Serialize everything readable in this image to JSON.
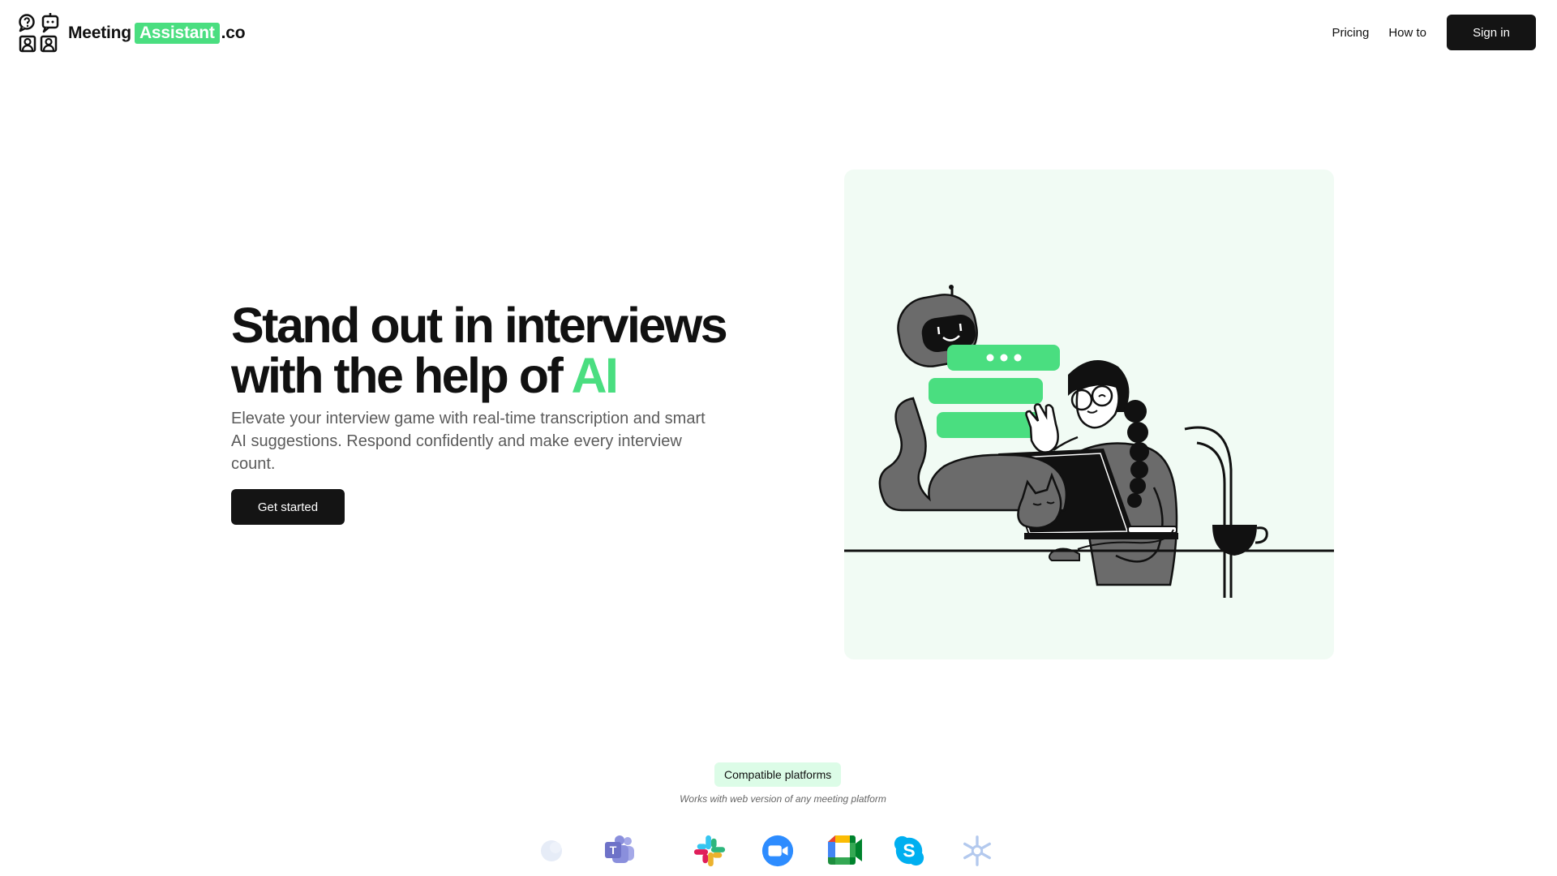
{
  "brand": {
    "name_prefix": "Meeting",
    "name_highlight": "Assistant",
    "name_suffix": ".co",
    "logo_icon": "chat-bot-people-icon"
  },
  "nav": {
    "pricing": "Pricing",
    "how_to": "How to",
    "sign_in": "Sign in"
  },
  "hero": {
    "title_line1": "Stand out in interviews",
    "title_line2_prefix": "with the help of ",
    "title_line2_highlight": "AI",
    "subtitle": "Elevate your interview game with real-time transcription and smart AI suggestions. Respond confidently and make every interview count.",
    "cta": "Get started",
    "illustration": "woman-at-laptop-with-robot-and-cat"
  },
  "platforms": {
    "badge": "Compatible platforms",
    "note": "Works with web version of any meeting platform",
    "items": [
      {
        "icon": "faded-platform-icon",
        "label": ""
      },
      {
        "icon": "microsoft-teams-icon",
        "label": ""
      },
      {
        "icon": "slack-icon",
        "label": ""
      },
      {
        "icon": "zoom-icon",
        "label": ""
      },
      {
        "icon": "google-meet-icon",
        "label": ""
      },
      {
        "icon": "skype-icon",
        "label": ""
      },
      {
        "icon": "snowflake-icon",
        "label": ""
      }
    ]
  },
  "colors": {
    "accent": "#4ade80",
    "dark": "#141414",
    "illustration_bg": "#f1fbf4",
    "badge_bg": "#dcfce7"
  }
}
